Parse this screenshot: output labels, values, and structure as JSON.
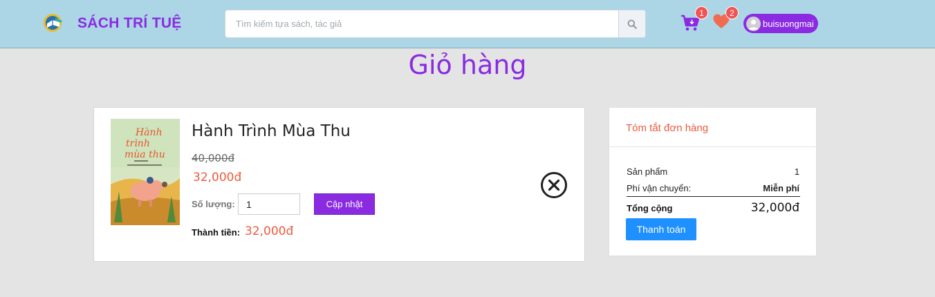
{
  "header": {
    "brand": "SÁCH TRÍ TUỆ",
    "search_placeholder": "Tìm kiếm tựa sách, tác giả",
    "cart_count": "1",
    "wishlist_count": "2",
    "username": "buisuongmai"
  },
  "page": {
    "title": "Giỏ hàng"
  },
  "cart": {
    "items": [
      {
        "title": "Hành Trình Mùa Thu",
        "cover_text": "Hành trình mùa thu",
        "old_price": "40,000đ",
        "price": "32,000đ",
        "quantity_label": "Số lượng:",
        "quantity": "1",
        "update_label": "Cập nhật",
        "subtotal_label": "Thành tiền:",
        "subtotal": "32,000đ"
      }
    ]
  },
  "summary": {
    "title": "Tóm tắt đơn hàng",
    "products_label": "Sản phẩm",
    "products_value": "1",
    "shipping_label": "Phí vận chuyển:",
    "shipping_value": "Miễn phí",
    "total_label": "Tổng cộng",
    "total_value": "32,000đ",
    "checkout_label": "Thanh toán"
  },
  "colors": {
    "header_bg": "#acd6e6",
    "brand": "#8a2be2",
    "price": "#ee5a3c",
    "checkout": "#1e90ff",
    "badge": "#f05454"
  }
}
